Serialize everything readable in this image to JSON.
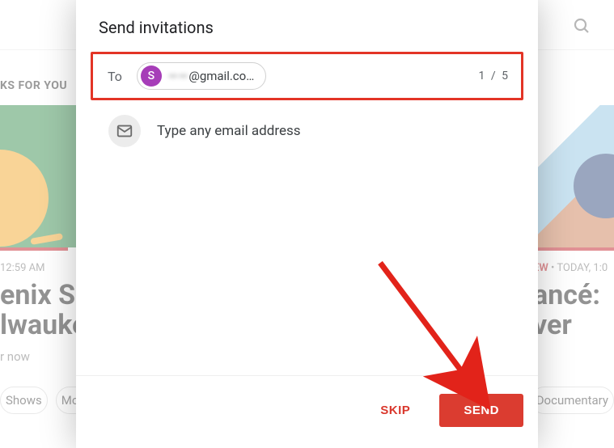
{
  "background": {
    "picks_label": "KS FOR YOU",
    "left_card": {
      "meta_time": "12:59 AM",
      "title_line1": "enix S",
      "title_line2": "lwaukee",
      "sub": "r now"
    },
    "right_card": {
      "meta_new": "EW",
      "meta_sep": " • ",
      "meta_time": "TODAY, 1:0",
      "title_line1": "ancé:",
      "title_line2": "ver"
    },
    "chips_left": [
      "Shows",
      "Mov"
    ],
    "chips_right": [
      "Documentary"
    ]
  },
  "modal": {
    "title": "Send invitations",
    "to_label": "To",
    "recipient": {
      "initial": "S",
      "obscured": "——",
      "domain": "@gmail.co…"
    },
    "counter": "1 / 5",
    "hint": "Type any email address",
    "skip_label": "SKIP",
    "send_label": "SEND"
  }
}
